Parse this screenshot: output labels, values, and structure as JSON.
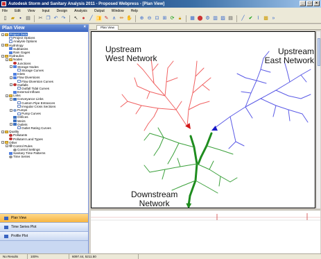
{
  "window": {
    "title": "Autodesk Storm and Sanitary Analysis 2011 - Proposed Webpress - [Plan View]"
  },
  "menu": [
    "File",
    "Edit",
    "View",
    "Input",
    "Design",
    "Analysis",
    "Output",
    "Window",
    "Help"
  ],
  "left_panel": {
    "title": "Plan View",
    "tree": [
      {
        "label": "Project Data",
        "depth": 0,
        "exp": "-",
        "icon": "folder",
        "selected": true
      },
      {
        "label": "Project Options",
        "depth": 1,
        "exp": "",
        "icon": "doc"
      },
      {
        "label": "Analysis Options",
        "depth": 1,
        "exp": "",
        "icon": "doc"
      },
      {
        "label": "Hydrology",
        "depth": 0,
        "exp": "-",
        "icon": "folder"
      },
      {
        "label": "Subbasins",
        "depth": 1,
        "exp": "",
        "icon": "blue"
      },
      {
        "label": "Rain Gages",
        "depth": 1,
        "exp": "",
        "icon": "blue"
      },
      {
        "label": "Hydraulics",
        "depth": 0,
        "exp": "-",
        "icon": "folder"
      },
      {
        "label": "Nodes",
        "depth": 1,
        "exp": "-",
        "icon": "folder"
      },
      {
        "label": "Junctions",
        "depth": 2,
        "exp": "",
        "icon": "node-i"
      },
      {
        "label": "Storage Nodes",
        "depth": 2,
        "exp": "-",
        "icon": "blue"
      },
      {
        "label": "Storage Curves",
        "depth": 3,
        "exp": "",
        "icon": "doc"
      },
      {
        "label": "Inlets",
        "depth": 2,
        "exp": "",
        "icon": "blue"
      },
      {
        "label": "Flow Diversions",
        "depth": 2,
        "exp": "-",
        "icon": "blue"
      },
      {
        "label": "Flow Diversion Curves",
        "depth": 3,
        "exp": "",
        "icon": "doc"
      },
      {
        "label": "Outfalls",
        "depth": 2,
        "exp": "-",
        "icon": "node-i"
      },
      {
        "label": "Outfall Tidal Curves",
        "depth": 3,
        "exp": "",
        "icon": "doc"
      },
      {
        "label": "External Inflows",
        "depth": 2,
        "exp": "",
        "icon": "blue"
      },
      {
        "label": "Links",
        "depth": 1,
        "exp": "-",
        "icon": "folder"
      },
      {
        "label": "Conveyance Links",
        "depth": 2,
        "exp": "-",
        "icon": "link"
      },
      {
        "label": "Custom Pipe Entrances",
        "depth": 3,
        "exp": "",
        "icon": "doc"
      },
      {
        "label": "Irregular Cross Sections",
        "depth": 3,
        "exp": "",
        "icon": "doc"
      },
      {
        "label": "Pumps",
        "depth": 2,
        "exp": "-",
        "icon": "pump"
      },
      {
        "label": "Pump Curves",
        "depth": 3,
        "exp": "",
        "icon": "doc"
      },
      {
        "label": "Orifices",
        "depth": 2,
        "exp": "",
        "icon": "link"
      },
      {
        "label": "Weirs",
        "depth": 2,
        "exp": "",
        "icon": "link"
      },
      {
        "label": "Outlets",
        "depth": 2,
        "exp": "-",
        "icon": "link"
      },
      {
        "label": "Outlet Rating Curves",
        "depth": 3,
        "exp": "",
        "icon": "doc"
      },
      {
        "label": "Quality",
        "depth": 0,
        "exp": "-",
        "icon": "folder"
      },
      {
        "label": "Pollutants",
        "depth": 1,
        "exp": "",
        "icon": "node-i"
      },
      {
        "label": "Pollutant Land Types",
        "depth": 1,
        "exp": "",
        "icon": "node-i"
      },
      {
        "label": "Other",
        "depth": 0,
        "exp": "-",
        "icon": "folder"
      },
      {
        "label": "Control Rules",
        "depth": 1,
        "exp": "-",
        "icon": "gear"
      },
      {
        "label": "Control Settings",
        "depth": 2,
        "exp": "",
        "icon": "gear"
      },
      {
        "label": "Sanitary Time Patterns",
        "depth": 1,
        "exp": "",
        "icon": "blue"
      },
      {
        "label": "Time Series",
        "depth": 1,
        "exp": "",
        "icon": "gear"
      }
    ],
    "bottom_buttons": [
      {
        "label": "Plan View",
        "active": true
      },
      {
        "label": "Time Series Plot",
        "active": false
      },
      {
        "label": "Profile Plot",
        "active": false
      }
    ]
  },
  "main": {
    "tab_label": "Plan View",
    "labels": {
      "upstream_west": "Upstream\nWest Network",
      "upstream_east": "Upstream\nEast Network",
      "downstream": "Downstream\nNetwork"
    },
    "colors": {
      "west": "#f06060",
      "east": "#5a5ae6",
      "downstream": "#3aa03a",
      "main_stem": "#1e8c1e"
    }
  },
  "statusbar": {
    "items": [
      "No Results",
      "100%",
      "6097.44, 5211.50"
    ]
  }
}
